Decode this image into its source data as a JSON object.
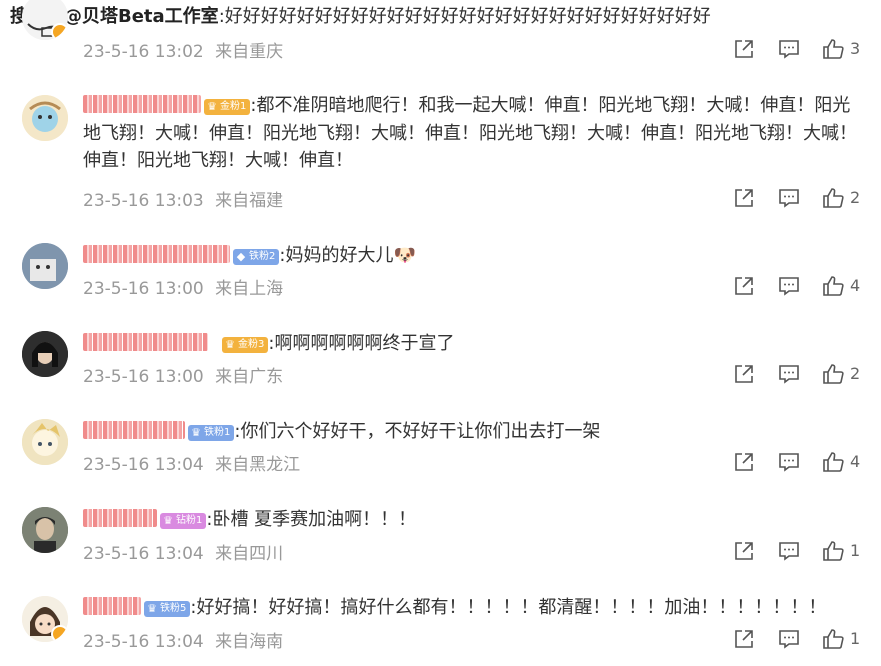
{
  "watermark": "搜狐号@贝塔Beta工作室",
  "comments": [
    {
      "text": ":好好好好好好好好好好好好好好好好好好好好好好好好好好好",
      "time": "23-5-16 13:02",
      "location": "来自重庆",
      "likes": "3"
    },
    {
      "fan_badge": "金粉1",
      "text": ":都不准阴暗地爬行！和我一起大喊！伸直！阳光地飞翔！大喊！伸直！阳光地飞翔！大喊！伸直！阳光地飞翔！大喊！伸直！阳光地飞翔！大喊！伸直！阳光地飞翔！大喊！伸直！阳光地飞翔！大喊！伸直！",
      "time": "23-5-16 13:03",
      "location": "来自福建",
      "likes": "2"
    },
    {
      "fan_badge": "铁粉2",
      "text": ":妈妈的好大儿",
      "time": "23-5-16 13:00",
      "location": "来自上海",
      "likes": "4"
    },
    {
      "fan_badge": "金粉3",
      "text": ":啊啊啊啊啊啊终于宣了",
      "time": "23-5-16 13:00",
      "location": "来自广东",
      "likes": "2"
    },
    {
      "fan_badge": "铁粉1",
      "text": ":你们六个好好干，不好好干让你们出去打一架",
      "time": "23-5-16 13:04",
      "location": "来自黑龙江",
      "likes": "4"
    },
    {
      "fan_badge": "钻粉1",
      "text": ":卧槽 夏季赛加油啊！！！",
      "time": "23-5-16 13:04",
      "location": "来自四川",
      "likes": "1"
    },
    {
      "fan_badge": "铁粉5",
      "text": ":好好搞！好好搞！搞好什么都有！！！！！都清醒！！！！加油！！！！！！！",
      "time": "23-5-16 13:04",
      "location": "来自海南",
      "likes": "1"
    }
  ],
  "icons": {
    "share": "share-icon",
    "comment": "comment-icon",
    "like": "like-icon",
    "emoji": "doge-emoji-icon",
    "crown": "crown-icon"
  },
  "colors": {
    "meta_text": "#999999",
    "gold_badge": "#f3b23e",
    "iron_badge": "#7ea6e8",
    "drill_badge": "#d98ae0"
  }
}
